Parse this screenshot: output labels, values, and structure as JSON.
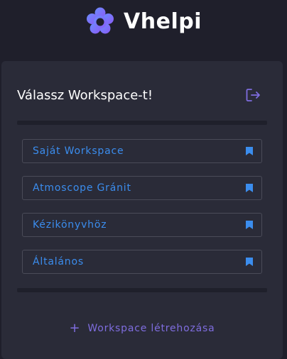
{
  "brand": {
    "name": "Vhelpi",
    "logo_icon": "flower-logo-icon"
  },
  "card": {
    "title": "Válassz Workspace-t!",
    "logout_icon": "logout-icon"
  },
  "workspaces": [
    {
      "label": "Saját Workspace",
      "icon": "bookmark-icon"
    },
    {
      "label": "Atmoscope Gránit",
      "icon": "bookmark-icon"
    },
    {
      "label": "Kézikönyvhöz",
      "icon": "bookmark-icon"
    },
    {
      "label": "Általános",
      "icon": "bookmark-icon"
    }
  ],
  "create": {
    "plus": "+",
    "label": "Workspace létrehozása"
  },
  "colors": {
    "background": "#1f1f2b",
    "card": "#2a2b38",
    "link_blue": "#3b8dee",
    "accent_purple": "#7f6ddf"
  }
}
